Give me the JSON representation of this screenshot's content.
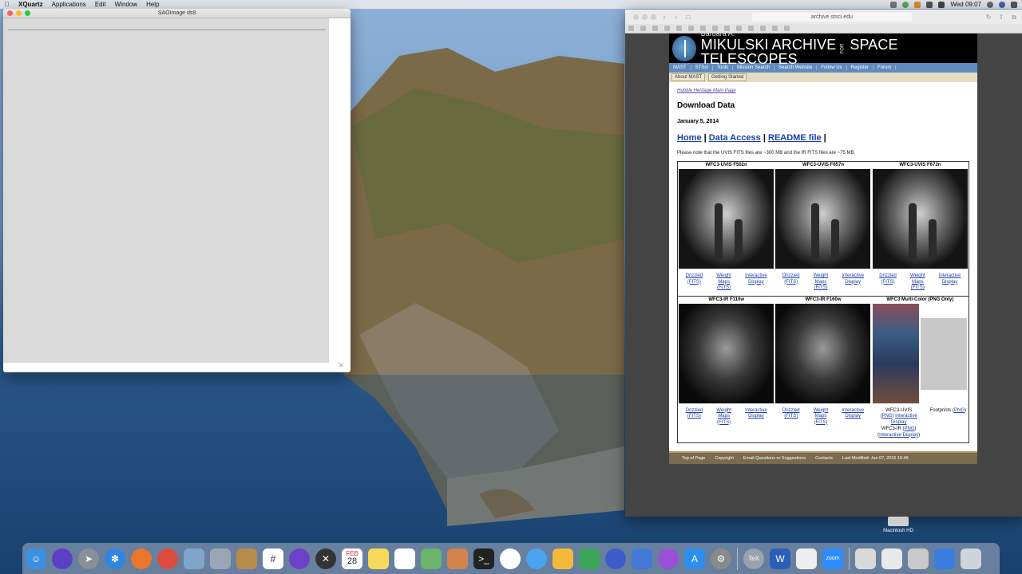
{
  "menubar": {
    "apple": "",
    "app_name": "XQuartz",
    "items": [
      "Applications",
      "Edit",
      "Window",
      "Help"
    ],
    "clock": "Wed 09:07"
  },
  "xquartz_window": {
    "title": "SAOImage ds9"
  },
  "safari": {
    "url": "archive.stsci.edu"
  },
  "mast": {
    "banner_small": "Barbara A.",
    "banner_big_1": "MIKULSKI ARCHIVE",
    "banner_for": "FOR",
    "banner_big_2": "SPACE TELESCOPES",
    "nav1": [
      "MAST",
      "STScI",
      "Tools",
      "Mission Search",
      "Search Website",
      "Follow Us",
      "Register",
      "Forum"
    ],
    "nav2": [
      "About MAST",
      "Getting Started"
    ],
    "crumb": "Hubble Heritage Main Page",
    "heading": "Download Data",
    "date": "January 5, 2014",
    "links": {
      "home": "Home",
      "sep1": " | ",
      "data_access": "Data Access",
      "sep2": " | ",
      "readme": "README file",
      "sep3": " |"
    },
    "note": "Please note that the UVIS FITS files are ~300 MB and the IR FITS files are ~75 MB.",
    "row1_heads": [
      "WFC3-UVIS F502n",
      "WFC3-UVIS F657n",
      "WFC3-UVIS F673n"
    ],
    "row2_heads": [
      "WFC3-IR F110w",
      "WFC3-IR F160w",
      "WFC3 Multi-Color (PNG Only)"
    ],
    "dl_links": {
      "drizzled_1": "Drizzled",
      "drizzled_2": "(FITS)",
      "weight_1": "Weight",
      "weight_2": "Maps",
      "weight_3": "(FITS)",
      "interactive_1": "Interactive",
      "interactive_2": "Display"
    },
    "multicolor": {
      "uvis_label": "WFC3-UVIS",
      "uvis_png": "PNG",
      "uvis_interactive": "Interactive Display",
      "ir_label": "WFC3-IR",
      "ir_png": "PNG",
      "ir_interactive": "Interactive Display",
      "footprints": "Footprints",
      "footprints_png": "PNG"
    },
    "footer": [
      "Top of Page",
      "Copyright",
      "Email Questions or Suggestions",
      "Contacts",
      "Last Modified: Jan 07, 2015 16:46"
    ]
  },
  "desktop": {
    "hd_label": "Macintosh HD"
  },
  "dock": {
    "icons": [
      "finder-icon",
      "siri-icon",
      "launchpad-icon",
      "safari-icon",
      "firefox-icon",
      "chrome-icon",
      "preview-icon",
      "photos-library-icon",
      "notes-folder-icon",
      "slack-icon",
      "github-icon",
      "xquartz-icon",
      "calendar-icon",
      "notes-icon",
      "reminders-icon",
      "maps-icon",
      "books-icon",
      "terminal-icon",
      "photos-icon",
      "messages-icon",
      "sketch-icon",
      "numbers-icon",
      "quicktime-icon",
      "keynote-icon",
      "podcasts-icon",
      "app-store-icon",
      "system-preferences-icon",
      "tex-icon",
      "word-icon",
      "textedit-icon",
      "zoom-icon",
      "downloads-icon",
      "documents-icon",
      "screenshots-icon",
      "window-icon",
      "trash-icon"
    ],
    "calendar_month": "FEB",
    "calendar_day": "28",
    "zoom_label": "zoom",
    "tex_label": "TeX",
    "word_label": "W"
  }
}
